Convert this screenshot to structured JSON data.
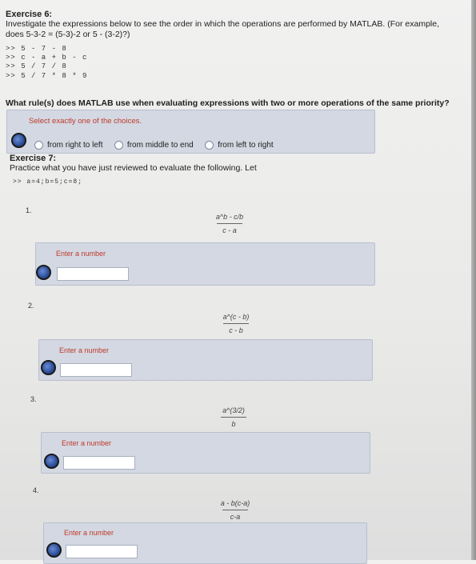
{
  "ex6": {
    "title": "Exercise 6:",
    "intro_line1": "Investigate the expressions below to see the order in which the operations are performed by MATLAB. (For example,",
    "intro_line2": "does 5-3-2 = (5-3)-2 or 5 - (3-2)?)",
    "code": [
      ">> 5 - 7 - 8",
      ">> c - a + b - c",
      ">> 5 / 7 / 8",
      ">> 5 / 7 * 8 * 9"
    ],
    "question": "What rule(s) does MATLAB use when evaluating expressions with two or more operations of the same priority?",
    "instruction": "Select exactly one of the choices.",
    "options": [
      "from right to left",
      "from middle to end",
      "from left to right"
    ]
  },
  "ex7": {
    "title": "Exercise 7:",
    "intro": "Practice what you have just reviewed to evaluate the following. Let",
    "code": ">> a=4;b=5;c=8;",
    "items": [
      {
        "num": "1.",
        "numerator": "a^b - c/b",
        "denominator": "c - a",
        "label": "Enter a number",
        "value": ""
      },
      {
        "num": "2.",
        "numerator": "a^(c - b)",
        "denominator": "c - b",
        "label": "Enter a number",
        "value": ""
      },
      {
        "num": "3.",
        "numerator": "a^(3/2)",
        "denominator": "b",
        "label": "Enter a number",
        "value": ""
      },
      {
        "num": "4.",
        "numerator": "a - b(c-a)",
        "denominator": "c-a",
        "label": "Enter a number",
        "value": ""
      }
    ]
  }
}
